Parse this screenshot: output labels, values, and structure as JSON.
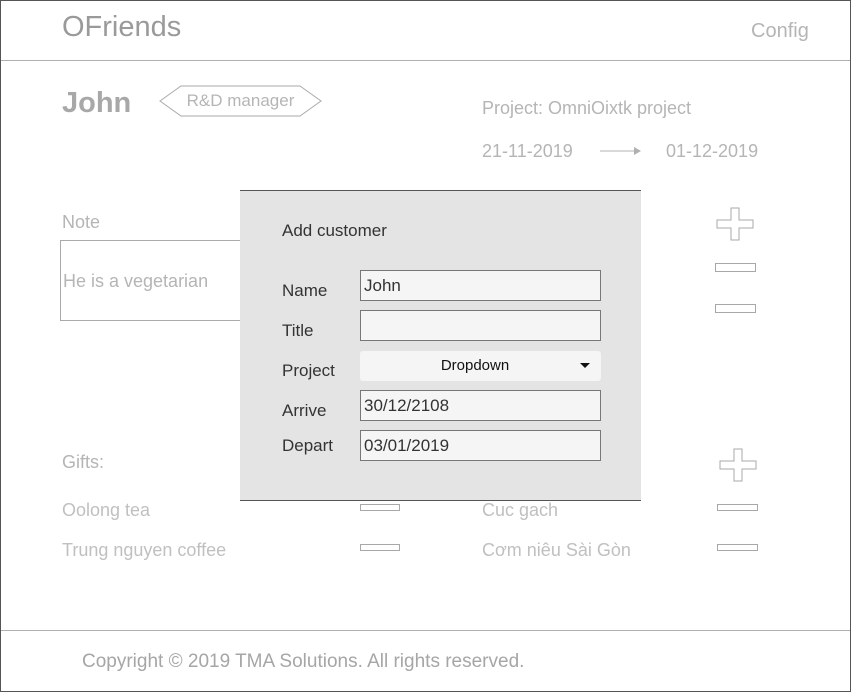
{
  "header": {
    "app_name": "OFriends",
    "config_label": "Config"
  },
  "profile": {
    "name": "John",
    "role": "R&D manager",
    "project_label": "Project: OmniOixtk project",
    "date_start": "21-11-2019",
    "date_end": "01-12-2019"
  },
  "note": {
    "label": "Note",
    "text": "He is a vegetarian"
  },
  "gifts": {
    "label": "Gifts:",
    "left": [
      "Oolong tea",
      "Trung nguyen coffee"
    ],
    "right": [
      "Cuc gach",
      "Cơm niêu Sài Gòn"
    ]
  },
  "modal": {
    "title": "Add customer",
    "fields": {
      "name": {
        "label": "Name",
        "value": "John"
      },
      "title": {
        "label": "Title",
        "value": ""
      },
      "project": {
        "label": "Project",
        "value": "Dropdown"
      },
      "arrive": {
        "label": "Arrive",
        "value": "30/12/2108"
      },
      "depart": {
        "label": "Depart",
        "value": "03/01/2019"
      }
    }
  },
  "footer": {
    "copyright": "Copyright © 2019 TMA Solutions. All rights reserved."
  }
}
